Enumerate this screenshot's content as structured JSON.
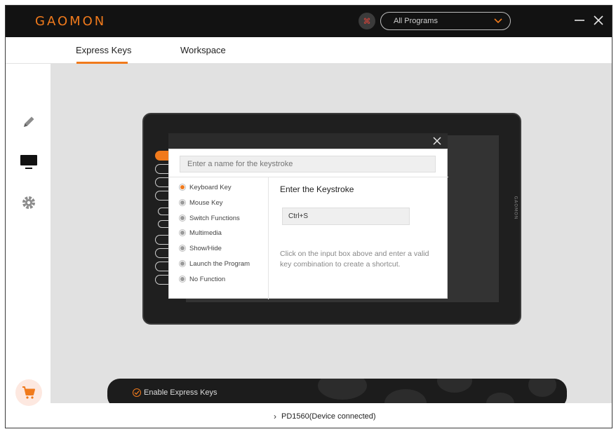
{
  "app": {
    "logo": "GAOMON"
  },
  "header": {
    "program_select": {
      "value": "All Programs"
    }
  },
  "tabs": [
    {
      "label": "Express Keys",
      "active": true
    },
    {
      "label": "Workspace",
      "active": false
    }
  ],
  "sidebar": {
    "items": [
      {
        "icon": "pen-icon"
      },
      {
        "icon": "monitor-icon",
        "active": true
      },
      {
        "icon": "gear-icon"
      }
    ],
    "cart_icon": "cart-icon"
  },
  "dialog": {
    "name_placeholder": "Enter a name for the keystroke",
    "options": [
      {
        "label": "Keyboard Key",
        "selected": true
      },
      {
        "label": "Mouse Key",
        "selected": false
      },
      {
        "label": "Switch Functions",
        "selected": false
      },
      {
        "label": "Multimedia",
        "selected": false
      },
      {
        "label": "Show/Hide",
        "selected": false
      },
      {
        "label": "Launch the Program",
        "selected": false
      },
      {
        "label": "No Function",
        "selected": false
      }
    ],
    "keystroke_title": "Enter the Keystroke",
    "keystroke_value": "Ctrl+S",
    "help_text": "Click on the input box above and  enter a valid key combination to create a shortcut."
  },
  "express_bar": {
    "enable_label": "Enable Express Keys",
    "enabled": true
  },
  "status": {
    "device": "PD1560(Device connected)"
  },
  "colors": {
    "accent": "#f07a1c",
    "titlebar": "#121212",
    "canvas": "#e1e1e1"
  }
}
